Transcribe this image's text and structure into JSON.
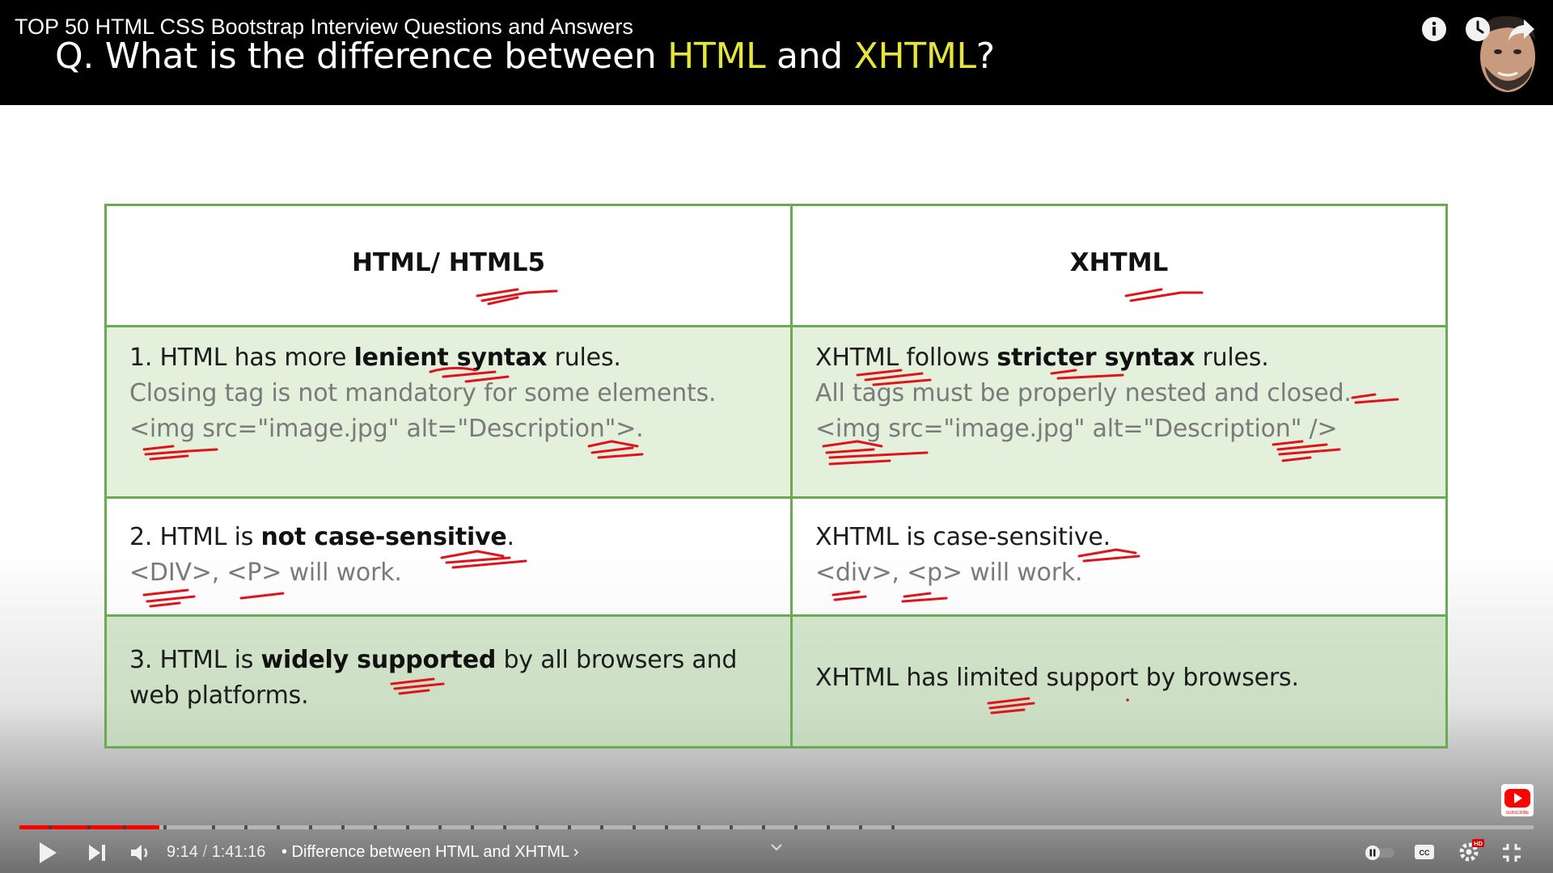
{
  "video": {
    "title": "TOP 50 HTML CSS Bootstrap Interview Questions and Answers"
  },
  "slide": {
    "question_prefix": "Q. What is the difference between ",
    "question_term1": "HTML",
    "question_mid": " and ",
    "question_term2": "XHTML",
    "question_suffix": "?",
    "table": {
      "headers": [
        "HTML/ HTML5",
        "XHTML"
      ],
      "rows": [
        {
          "left": {
            "line1_prefix": "1.   HTML has more ",
            "line1_bold": "lenient syntax",
            "line1_suffix": " rules.",
            "line2": "Closing tag is not mandatory for some elements.",
            "line3": "<img src=\"image.jpg\" alt=\"Description\">."
          },
          "right": {
            "line1_prefix": "XHTML follows ",
            "line1_bold": "stricter syntax",
            "line1_suffix": " rules.",
            "line2": "All tags must be properly nested and closed.",
            "line3": "<img src=\"image.jpg\" alt=\"Description\" />"
          }
        },
        {
          "left": {
            "line1_prefix": "2. HTML is ",
            "line1_bold": "not case-sensitive",
            "line1_suffix": ".",
            "line2": "<DIV>, <P> will work."
          },
          "right": {
            "line1": "XHTML is case-sensitive.",
            "line2": "<div>, <p> will work."
          }
        },
        {
          "left": {
            "line1_prefix": "3. HTML is ",
            "line1_bold": "widely supported",
            "line1_suffix": " by all browsers and",
            "line2": "web platforms."
          },
          "right": {
            "line1": "XHTML has limited support by browsers."
          }
        }
      ]
    }
  },
  "player": {
    "current_time": "9:14",
    "time_separator": " / ",
    "duration": "1:41:16",
    "chapter": "• Difference between HTML and XHTML",
    "chapter_chevron": "›",
    "progress_fraction": 0.0924,
    "hd_badge": "HD",
    "cc_label": "CC",
    "subscribe_label": "SUBSCRIBE"
  },
  "colors": {
    "highlight": "#e5e53a",
    "table_border": "#6aaa52",
    "annotation_red": "#e0131b",
    "progress_red": "#ff0000"
  },
  "icons": {
    "info": "info-icon",
    "watch_later": "clock-icon",
    "share": "share-arrow-icon",
    "play": "play-icon",
    "next": "next-icon",
    "volume": "volume-icon",
    "chapters_expand": "chevron-down-icon",
    "autoplay": "autoplay-toggle-icon",
    "captions": "cc-icon",
    "settings": "gear-icon",
    "exit_fullscreen": "exit-fullscreen-icon"
  }
}
